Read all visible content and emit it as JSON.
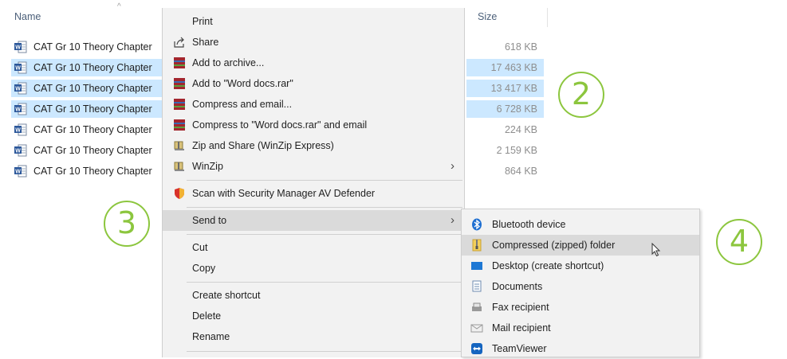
{
  "columns": {
    "name": "Name",
    "size": "Size"
  },
  "files": [
    {
      "name": "CAT Gr 10 Theory Chapter",
      "size": "618 KB",
      "selected": false
    },
    {
      "name": "CAT Gr 10 Theory Chapter",
      "size": "17 463 KB",
      "selected": true
    },
    {
      "name": "CAT Gr 10 Theory Chapter",
      "size": "13 417 KB",
      "selected": true
    },
    {
      "name": "CAT Gr 10 Theory Chapter",
      "size": "6 728 KB",
      "selected": true
    },
    {
      "name": "CAT Gr 10 Theory Chapter",
      "size": "224 KB",
      "selected": false
    },
    {
      "name": "CAT Gr 10 Theory Chapter",
      "size": "2 159 KB",
      "selected": false
    },
    {
      "name": "CAT Gr 10 Theory Chapter",
      "size": "864 KB",
      "selected": false
    }
  ],
  "callouts": {
    "two": "2",
    "three": "3",
    "four": "4"
  },
  "context_menu": {
    "print": "Print",
    "share": "Share",
    "add_to_archive": "Add to archive...",
    "add_to_rar": "Add to \"Word docs.rar\"",
    "compress_email": "Compress and email...",
    "compress_rar_email": "Compress to \"Word docs.rar\" and email",
    "zip_share": "Zip and Share (WinZip Express)",
    "winzip": "WinZip",
    "scan": "Scan with Security Manager AV Defender",
    "send_to": "Send to",
    "cut": "Cut",
    "copy": "Copy",
    "create_shortcut": "Create shortcut",
    "delete": "Delete",
    "rename": "Rename"
  },
  "send_to_menu": {
    "bluetooth": "Bluetooth device",
    "compressed": "Compressed (zipped) folder",
    "desktop": "Desktop (create shortcut)",
    "documents": "Documents",
    "fax": "Fax recipient",
    "mail": "Mail recipient",
    "teamviewer": "TeamViewer"
  },
  "colors": {
    "selection": "#cce8ff",
    "callout": "#8cc63e",
    "menu_bg": "#f2f2f2",
    "menu_hover": "#dadada",
    "word_blue": "#2b579a",
    "winrar_red": "#a3262e"
  }
}
